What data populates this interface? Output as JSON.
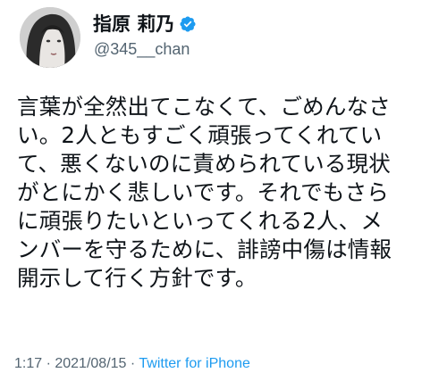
{
  "author": {
    "display_name": "指原 莉乃",
    "handle": "@345__chan",
    "verified_icon": "verified-badge-icon",
    "avatar": "profile-photo"
  },
  "tweet": {
    "lines": [
      "言葉が全然出てこなくて、ごめんなさ",
      "い。2人ともすごく頑張ってくれてい",
      "て、悪くないのに責められている現状",
      "がとにかく悲しいです。それでもさら",
      "に頑張りたいといってくれる2人、メ",
      "ンバーを守るために、誹謗中傷は情報",
      "開示して行く方針です。"
    ]
  },
  "meta": {
    "time": "1:17",
    "separator": " · ",
    "date": "2021/08/15",
    "separator2": " · ",
    "source": "Twitter for iPhone"
  },
  "colors": {
    "text": "#0f1419",
    "secondary": "#536471",
    "accent": "#1d9bf0"
  }
}
